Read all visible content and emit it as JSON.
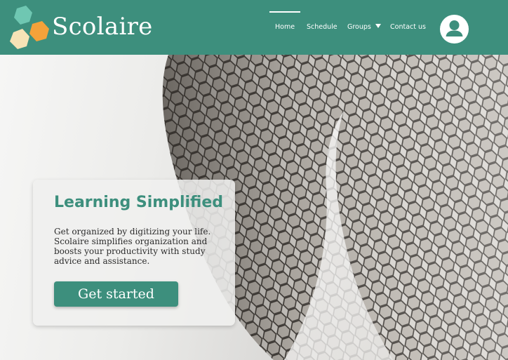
{
  "header": {
    "brand": "Scolaire",
    "logo_icon": "hexagon-cluster-icon",
    "nav": [
      {
        "label": "Home",
        "active": true
      },
      {
        "label": "Schedule",
        "active": false
      },
      {
        "label": "Groups",
        "active": false,
        "has_dropdown": true
      },
      {
        "label": "Contact us",
        "active": false
      }
    ],
    "avatar_icon": "user-avatar-icon"
  },
  "hero": {
    "background_image": "hexagonal-facade-photo",
    "card": {
      "title": "Learning Simplified",
      "body": "Get organized by digitizing your life. Scolaire simplifies organization and boosts your productivity with study advice and assistance.",
      "cta_label": "Get started"
    }
  },
  "colors": {
    "brand": "#3d8f7d",
    "hex_teal": "#6fc7b2",
    "hex_orange": "#f4a23a",
    "hex_cream": "#f6e3b6"
  }
}
